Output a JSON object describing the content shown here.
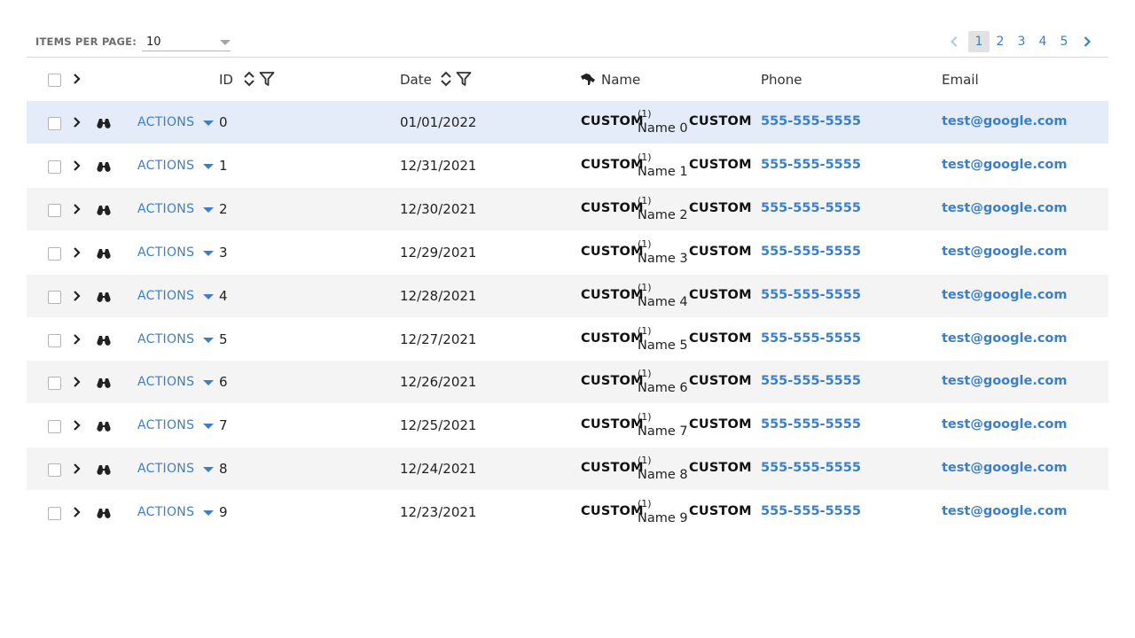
{
  "toolbar": {
    "items_per_page_label": "ITEMS PER PAGE:",
    "items_per_page_value": "10"
  },
  "pagination": {
    "pages": [
      "1",
      "2",
      "3",
      "4",
      "5"
    ],
    "current": "1"
  },
  "columns": {
    "id": "ID",
    "date": "Date",
    "name": "Name",
    "phone": "Phone",
    "email": "Email"
  },
  "actions_label": "ACTIONS",
  "custom_label": "CUSTOM",
  "name_badge": "(1)",
  "colors": {
    "accent": "#3b7fc9",
    "selected_row": "#e3ecf8",
    "striped_row": "#f4f4f4"
  },
  "rows": [
    {
      "id": "0",
      "date": "01/01/2022",
      "name": "Name 0",
      "phone": "555-555-5555",
      "email": "test@google.com",
      "selected": true
    },
    {
      "id": "1",
      "date": "12/31/2021",
      "name": "Name 1",
      "phone": "555-555-5555",
      "email": "test@google.com"
    },
    {
      "id": "2",
      "date": "12/30/2021",
      "name": "Name 2",
      "phone": "555-555-5555",
      "email": "test@google.com"
    },
    {
      "id": "3",
      "date": "12/29/2021",
      "name": "Name 3",
      "phone": "555-555-5555",
      "email": "test@google.com"
    },
    {
      "id": "4",
      "date": "12/28/2021",
      "name": "Name 4",
      "phone": "555-555-5555",
      "email": "test@google.com"
    },
    {
      "id": "5",
      "date": "12/27/2021",
      "name": "Name 5",
      "phone": "555-555-5555",
      "email": "test@google.com"
    },
    {
      "id": "6",
      "date": "12/26/2021",
      "name": "Name 6",
      "phone": "555-555-5555",
      "email": "test@google.com"
    },
    {
      "id": "7",
      "date": "12/25/2021",
      "name": "Name 7",
      "phone": "555-555-5555",
      "email": "test@google.com"
    },
    {
      "id": "8",
      "date": "12/24/2021",
      "name": "Name 8",
      "phone": "555-555-5555",
      "email": "test@google.com"
    },
    {
      "id": "9",
      "date": "12/23/2021",
      "name": "Name 9",
      "phone": "555-555-5555",
      "email": "test@google.com"
    }
  ]
}
